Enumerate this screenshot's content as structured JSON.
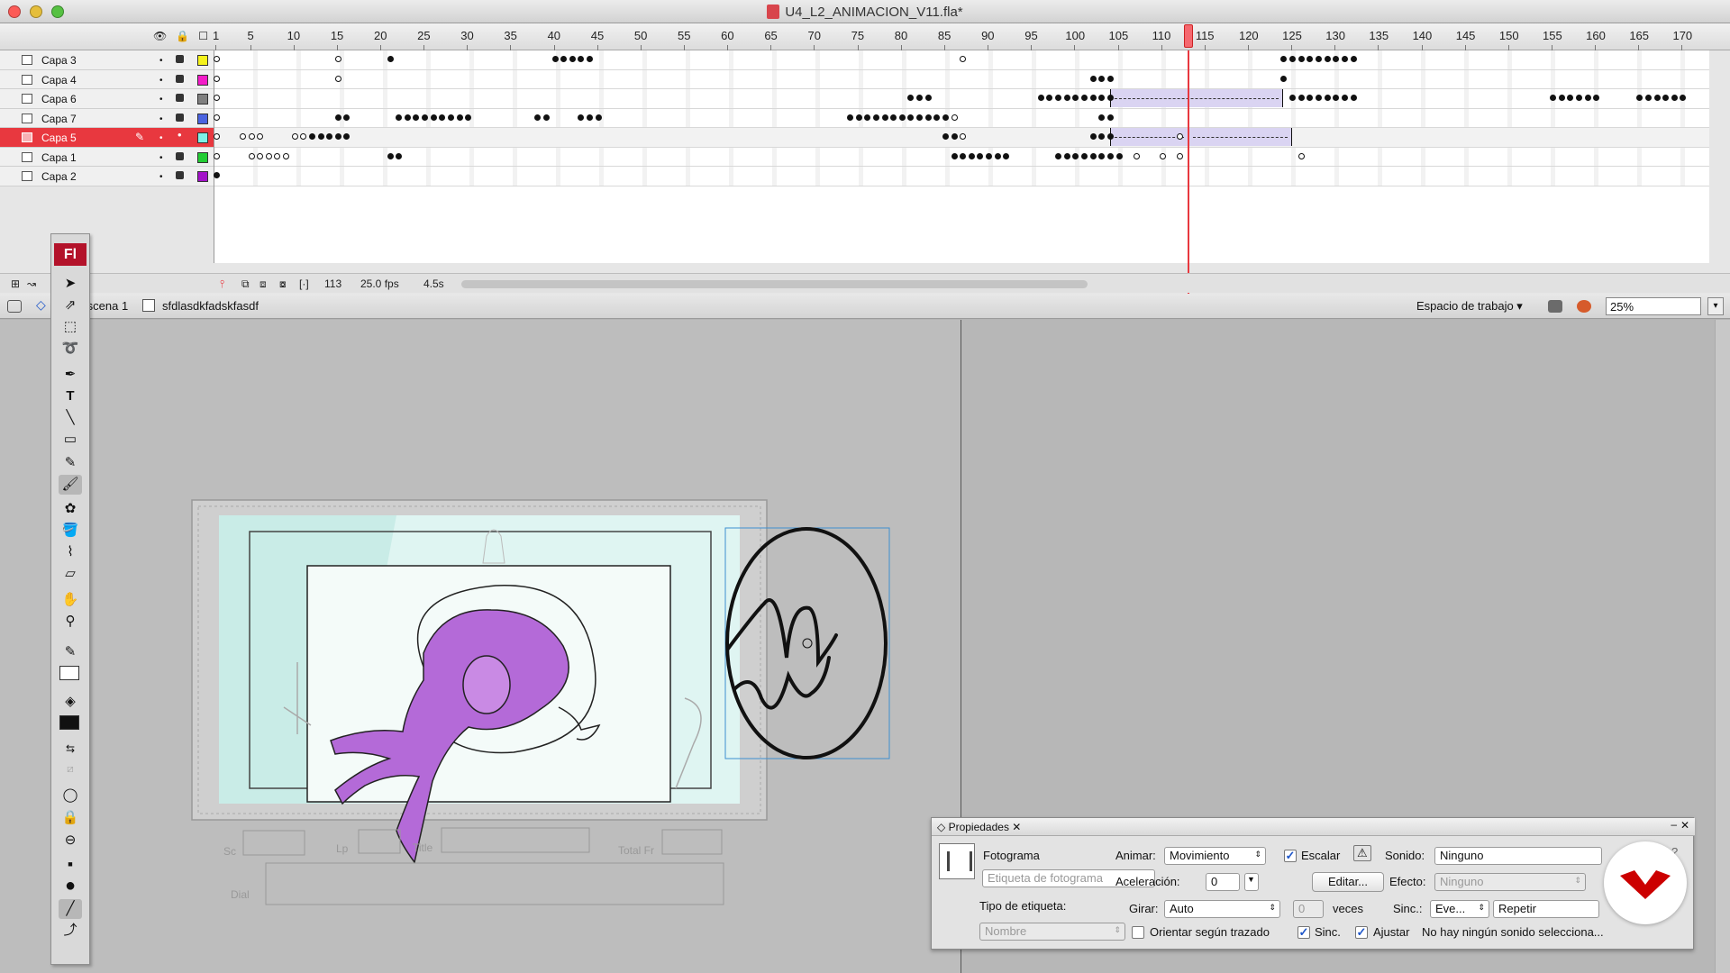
{
  "window": {
    "title": "U4_L2_ANIMACION_V11.fla*",
    "icons": [
      "close-button",
      "minimize-button",
      "maximize-button",
      "fla-file-icon"
    ]
  },
  "timeline": {
    "frame_numbers": [
      "1",
      "5",
      "10",
      "15",
      "20",
      "25",
      "30",
      "35",
      "40",
      "45",
      "50",
      "55",
      "60",
      "65",
      "70",
      "75",
      "80",
      "85",
      "90",
      "95",
      "100",
      "105",
      "110",
      "115",
      "120",
      "125",
      "130",
      "135",
      "140",
      "145",
      "150",
      "155",
      "160",
      "165",
      "170"
    ],
    "current_frame": 113,
    "layers": [
      {
        "name": "Capa 3",
        "color": "#f5f21c"
      },
      {
        "name": "Capa 4",
        "color": "#f31cc8"
      },
      {
        "name": "Capa 6",
        "color": "#808080"
      },
      {
        "name": "Capa 7",
        "color": "#4a63e0"
      },
      {
        "name": "Capa 5",
        "color": "#7ff0e6",
        "active": true
      },
      {
        "name": "Capa 1",
        "color": "#22cc33"
      },
      {
        "name": "Capa 2",
        "color": "#a312c8"
      }
    ],
    "status": {
      "frame": "113",
      "fps": "25.0 fps",
      "time": "4.5s"
    }
  },
  "editbar": {
    "scene": "Escena 1",
    "symbol": "sfdlasdkfadskfasdf",
    "workspace": "Espacio de trabajo ▾",
    "zoom": "25%"
  },
  "stage_labels": {
    "sc": "Sc",
    "lp": "Lp",
    "title": "Title",
    "total": "Total Fr",
    "dial": "Dial"
  },
  "properties": {
    "panel_title": "Propiedades",
    "section": "Fotograma",
    "frame_label_placeholder": "Etiqueta de fotograma",
    "label_type": "Tipo de etiqueta:",
    "label_type_value": "Nombre",
    "animate_label": "Animar:",
    "animate_value": "Movimiento",
    "scale_label": "Escalar",
    "ease_label": "Aceleración:",
    "ease_value": "0",
    "edit_button": "Editar...",
    "rotate_label": "Girar:",
    "rotate_value": "Auto",
    "rotate_times": "0",
    "times_label": "veces",
    "orient_label": "Orientar según trazado",
    "sync_check_label": "Sinc.",
    "snap_label": "Ajustar",
    "sound_label": "Sonido:",
    "sound_value": "Ninguno",
    "effect_label": "Efecto:",
    "effect_value": "Ninguno",
    "sync_label": "Sinc.:",
    "sync_value": "Eve...",
    "repeat_value": "Repetir",
    "no_sound_msg": "No hay ningún sonido selecciona..."
  },
  "tools_logo": "Fl",
  "colors": {
    "accent": "#e8383f",
    "tween": "#dad4f2",
    "character": "#b46ad8",
    "stage_bg": "#dff5f2",
    "brand": "#cc0000"
  }
}
